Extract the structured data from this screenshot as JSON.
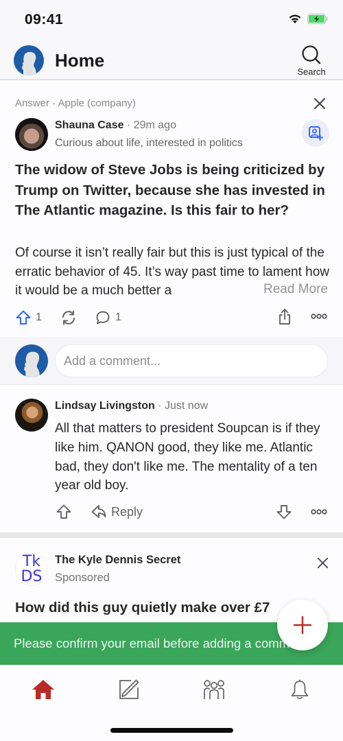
{
  "status_bar": {
    "time": "09:41",
    "icons": [
      "wifi-icon",
      "battery-charging-icon"
    ],
    "battery_color": "#4cd964"
  },
  "header": {
    "title": "Home",
    "search_label": "Search",
    "icons": [
      "profile-avatar-icon",
      "search-icon"
    ]
  },
  "answer_card": {
    "context": "Answer · Apple (company)",
    "author": {
      "name": "Shauna Case",
      "time": " · 29m ago",
      "credential": "Curious about life, interested in politics"
    },
    "question": "The widow of Steve Jobs is being criticized by Trump on Twitter, because she has invested in The Atlantic magazine. Is this fair to her?",
    "answer_text": "Of course it isn’t really fair but this is just typical of the erratic behavior of 45. It’s way past time to lament how it would be a much better a",
    "read_more": "Read More",
    "actions": {
      "upvote_count": "1",
      "comment_count": "1",
      "icons": [
        "upvote-icon",
        "share-reshare-icon",
        "comment-icon",
        "share-icon",
        "more-icon"
      ]
    },
    "accent_color": "#2e69ff"
  },
  "comment_input": {
    "placeholder": "Add a comment..."
  },
  "comment": {
    "author": "Lindsay Livingston",
    "time": " · Just now",
    "text": "All that matters to president Soupcan is if they like him. QANON good, they like me. Atlantic bad, they don't like me. The mentality of a ten year old boy.",
    "reply_label": "Reply"
  },
  "sponsored": {
    "logo_line1": "Tk",
    "logo_line2": "DS",
    "name": "The Kyle Dennis Secret",
    "label": "Sponsored",
    "headline": "How did this guy quietly make over £7"
  },
  "toast": {
    "message": "Please confirm your email before adding a comment.",
    "color": "#3aa65a"
  },
  "fab": {
    "icon": "plus-icon",
    "color": "#b92b27"
  },
  "bottom_nav": {
    "items": [
      {
        "name": "home",
        "icon": "home-icon",
        "active": true
      },
      {
        "name": "write",
        "icon": "edit-icon",
        "active": false
      },
      {
        "name": "spaces",
        "icon": "people-icon",
        "active": false
      },
      {
        "name": "notifications",
        "icon": "bell-icon",
        "active": false
      }
    ],
    "active_color": "#b92b27"
  }
}
